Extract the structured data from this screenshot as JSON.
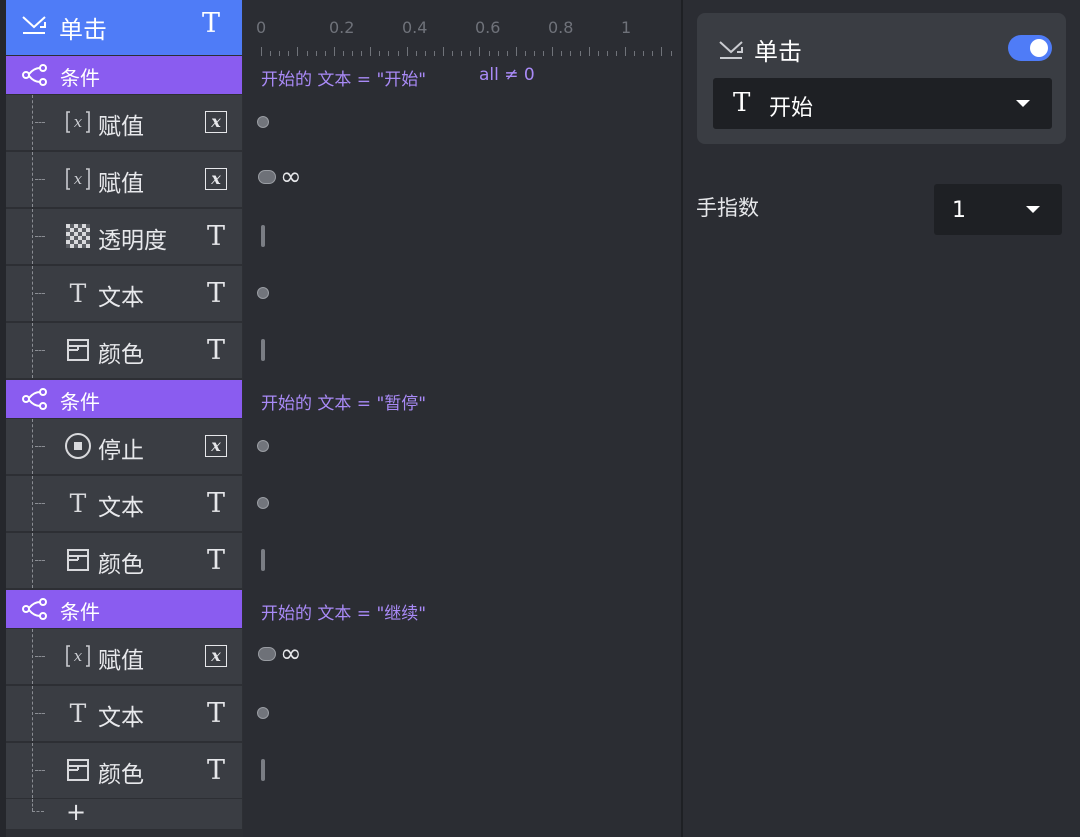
{
  "event": {
    "label": "单击",
    "icon": "swipe-down-icon",
    "type_icon": "T"
  },
  "rows": [
    {
      "kind": "condition",
      "label": "条件",
      "icon": "branch-icon"
    },
    {
      "kind": "action",
      "label": "赋值",
      "icon": "variable-icon",
      "type": "x"
    },
    {
      "kind": "action",
      "label": "赋值",
      "icon": "variable-icon",
      "type": "x"
    },
    {
      "kind": "action",
      "label": "透明度",
      "icon": "checker-icon",
      "type": "T"
    },
    {
      "kind": "action",
      "label": "文本",
      "icon": "text-icon",
      "type": "T"
    },
    {
      "kind": "action",
      "label": "颜色",
      "icon": "color-box-icon",
      "type": "T"
    },
    {
      "kind": "condition",
      "label": "条件",
      "icon": "branch-icon"
    },
    {
      "kind": "action",
      "label": "停止",
      "icon": "stop-icon",
      "type": "x"
    },
    {
      "kind": "action",
      "label": "文本",
      "icon": "text-icon",
      "type": "T"
    },
    {
      "kind": "action",
      "label": "颜色",
      "icon": "color-box-icon",
      "type": "T"
    },
    {
      "kind": "condition",
      "label": "条件",
      "icon": "branch-icon"
    },
    {
      "kind": "action",
      "label": "赋值",
      "icon": "variable-icon",
      "type": "x"
    },
    {
      "kind": "action",
      "label": "文本",
      "icon": "text-icon",
      "type": "T"
    },
    {
      "kind": "action",
      "label": "颜色",
      "icon": "color-box-icon",
      "type": "T"
    }
  ],
  "add_label": "+",
  "timeline": {
    "ticks": [
      "0",
      "0.2",
      "0.4",
      "0.6",
      "0.8",
      "1"
    ],
    "conditions": [
      "开始的 文本 = \"开始\"",
      "开始的 文本 = \"暂停\"",
      "开始的 文本 = \"继续\""
    ],
    "condition_extra": "all ≠ 0",
    "markers": [
      "dot",
      "loop",
      "bar",
      "dot",
      "bar",
      "dot",
      "dot",
      "bar",
      "loop",
      "dot",
      "bar"
    ],
    "infinity": "∞"
  },
  "panel": {
    "event_title": "单击",
    "toggle_on": true,
    "trigger_type_icon": "T",
    "trigger_value": "开始",
    "finger_label": "手指数",
    "finger_value": "1"
  },
  "colors": {
    "event": "#4f7cf7",
    "condition": "#8a5cf0",
    "condition_text": "#a98af7"
  }
}
